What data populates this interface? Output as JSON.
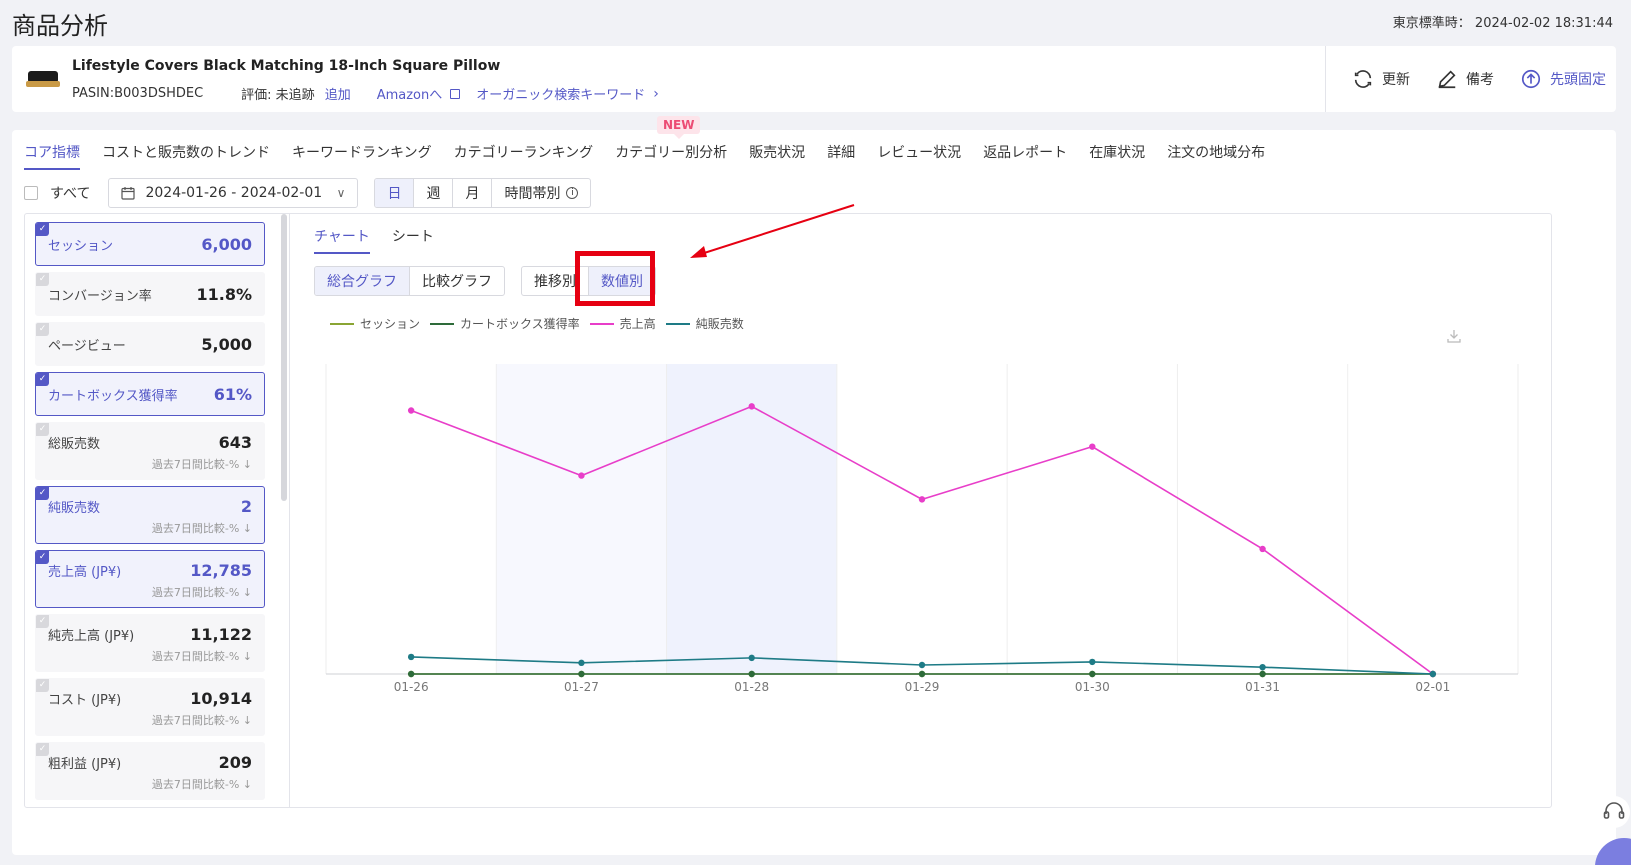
{
  "page": {
    "title": "商品分析",
    "timestamp": "東京標準時： 2024-02-02 18:31:44"
  },
  "product": {
    "title": "Lifestyle Covers Black Matching 18-Inch Square Pillow",
    "asin_label": "PASIN: ",
    "asin": "B003DSHDEC",
    "rating_label": "評価: 未追跡",
    "add_label": "追加",
    "amazon_label": "Amazonへ",
    "organic_label": "オーガニック検索キーワード"
  },
  "actions": {
    "refresh": "更新",
    "note": "備考",
    "pin": "先頭固定"
  },
  "tabs": [
    {
      "label": "コア指標",
      "active": true
    },
    {
      "label": "コストと販売数のトレンド"
    },
    {
      "label": "キーワードランキング"
    },
    {
      "label": "カテゴリーランキング"
    },
    {
      "label": "カテゴリー別分析"
    },
    {
      "label": "販売状況"
    },
    {
      "label": "詳細"
    },
    {
      "label": "レビュー状況"
    },
    {
      "label": "返品レポート"
    },
    {
      "label": "在庫状況"
    },
    {
      "label": "注文の地域分布"
    }
  ],
  "new_badge": "NEW",
  "filters": {
    "all_label": "すべて",
    "date_range": "2024-01-26 - 2024-02-01",
    "periods": [
      "日",
      "週",
      "月",
      "時間帯別"
    ]
  },
  "metrics": [
    {
      "label": "セッション",
      "value": "6,000",
      "selected": true
    },
    {
      "label": "コンバージョン率",
      "value": "11.8%",
      "selected": false
    },
    {
      "label": "ページビュー",
      "value": "5,000",
      "selected": false
    },
    {
      "label": "カートボックス獲得率",
      "value": "61%",
      "selected": true
    },
    {
      "label": "総販売数",
      "value": "643",
      "selected": false,
      "sub": "過去7日間比較-% ↓"
    },
    {
      "label": "純販売数",
      "value": "2",
      "selected": true,
      "sub": "過去7日間比較-% ↓"
    },
    {
      "label": "売上高 (JP¥)",
      "value": "12,785",
      "selected": true,
      "sub": "過去7日間比較-% ↓"
    },
    {
      "label": "純売上高 (JP¥)",
      "value": "11,122",
      "selected": false,
      "sub": "過去7日間比較-% ↓"
    },
    {
      "label": "コスト (JP¥)",
      "value": "10,914",
      "selected": false,
      "sub": "過去7日間比較-% ↓"
    },
    {
      "label": "粗利益 (JP¥)",
      "value": "209",
      "selected": false,
      "sub": "過去7日間比較-% ↓"
    }
  ],
  "chart_tabs": {
    "chart": "チャート",
    "sheet": "シート"
  },
  "graph_toggle": [
    "総合グラフ",
    "比較グラフ"
  ],
  "mode_toggle": [
    "推移別",
    "数値別"
  ],
  "colors": {
    "accent": "#5458c6",
    "session": "#8aa534",
    "cartbox": "#2e6b3a",
    "sales": "#e83ec9",
    "netunits": "#1e7b86",
    "highlight": "#e60012"
  },
  "chart_data": {
    "type": "line",
    "x": [
      "01-26",
      "01-27",
      "01-28",
      "01-29",
      "01-30",
      "01-31",
      "02-01"
    ],
    "series": [
      {
        "name": "セッション",
        "values": [
          0,
          0,
          0,
          0,
          0,
          0,
          0
        ]
      },
      {
        "name": "カートボックス獲得率",
        "values": [
          0,
          0,
          0,
          0,
          0,
          0,
          0
        ]
      },
      {
        "name": "売上高",
        "values": [
          2550,
          1920,
          2590,
          1690,
          2200,
          1210,
          0
        ]
      },
      {
        "name": "純販売数",
        "values": [
          0.55,
          0.36,
          0.52,
          0.29,
          0.39,
          0.22,
          0
        ]
      }
    ],
    "ylim": [
      0,
      3000
    ],
    "grid": "vertical",
    "legend": "top-left"
  }
}
